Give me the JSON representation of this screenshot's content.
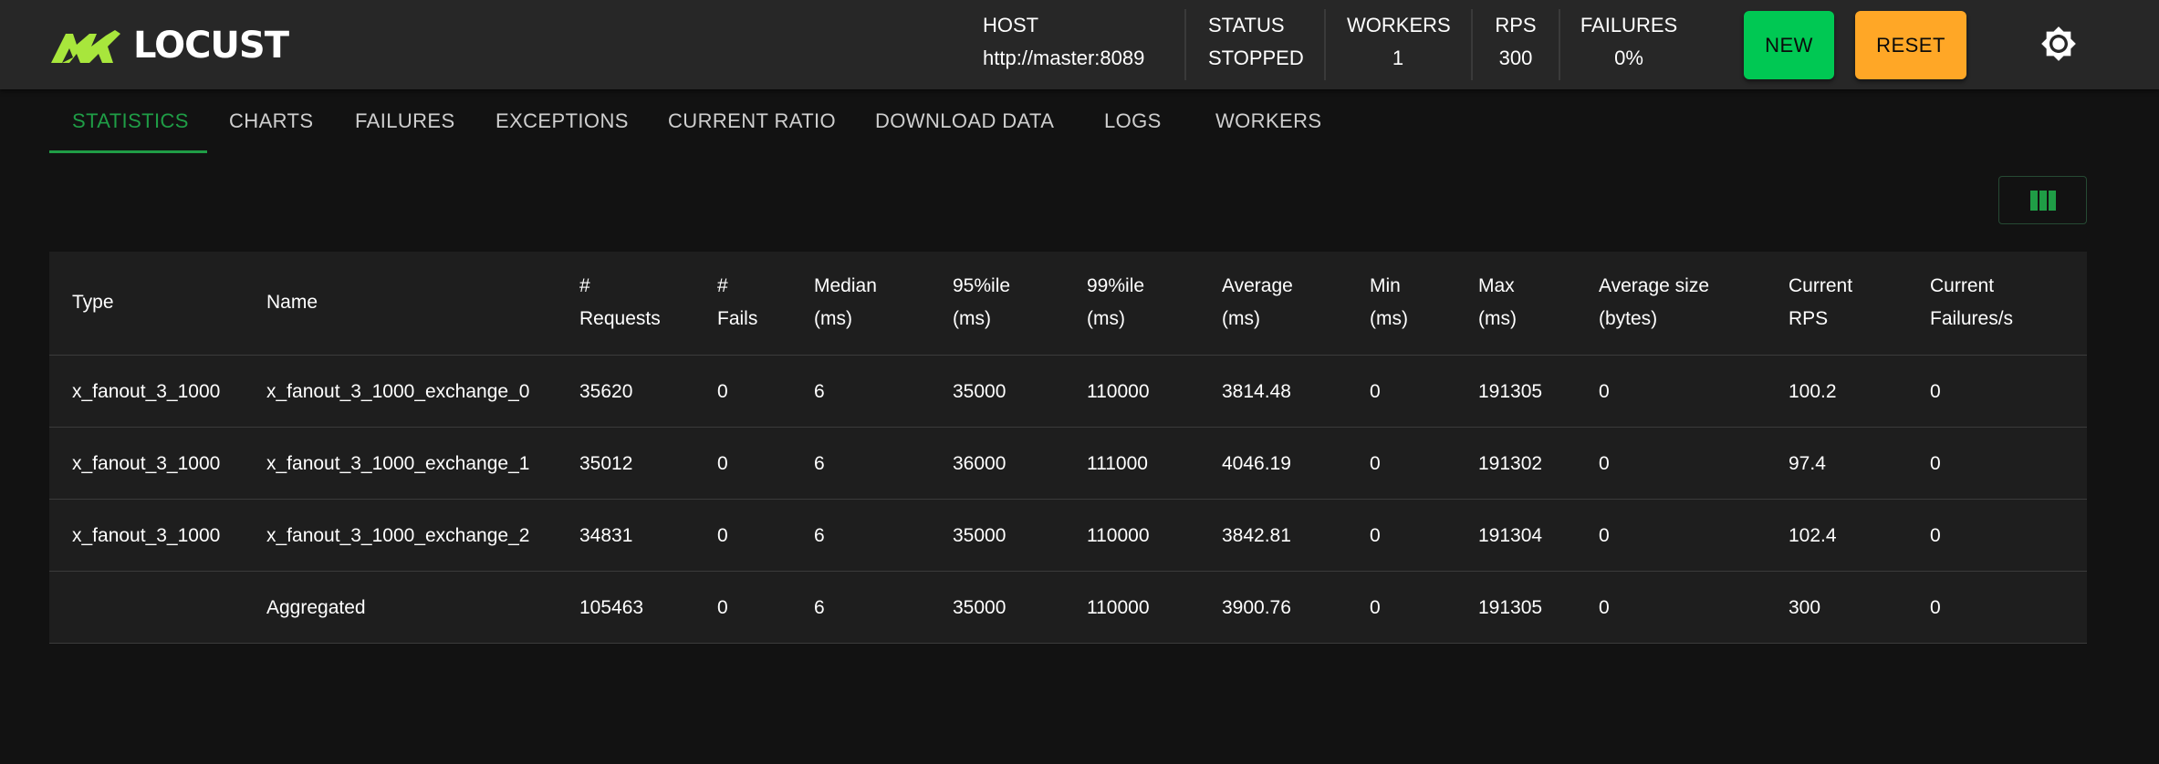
{
  "app": {
    "title": "LOCUST",
    "brand_color": "#a8e63c",
    "accent": "#1f9d46"
  },
  "header": {
    "host": {
      "label": "HOST",
      "value": "http://master:8089"
    },
    "status": {
      "label": "STATUS",
      "value": "STOPPED"
    },
    "workers": {
      "label": "WORKERS",
      "value": "1"
    },
    "rps": {
      "label": "RPS",
      "value": "300"
    },
    "failures": {
      "label": "FAILURES",
      "value": "0%"
    },
    "new_button": "NEW",
    "reset_button": "RESET",
    "theme_icon": "brightness-icon"
  },
  "tabs": [
    {
      "label": "STATISTICS",
      "active": true
    },
    {
      "label": "CHARTS"
    },
    {
      "label": "FAILURES"
    },
    {
      "label": "EXCEPTIONS"
    },
    {
      "label": "CURRENT RATIO"
    },
    {
      "label": "DOWNLOAD DATA"
    },
    {
      "label": "LOGS"
    },
    {
      "label": "WORKERS"
    }
  ],
  "toolbar": {
    "columns_icon": "view-column-icon"
  },
  "table": {
    "columns": [
      "Type",
      "Name",
      "#\nRequests",
      "#\nFails",
      "Median\n(ms)",
      "95%ile\n(ms)",
      "99%ile\n(ms)",
      "Average\n(ms)",
      "Min\n(ms)",
      "Max\n(ms)",
      "Average size\n(bytes)",
      "Current\nRPS",
      "Current\nFailures/s"
    ],
    "rows": [
      [
        "x_fanout_3_1000",
        "x_fanout_3_1000_exchange_0",
        "35620",
        "0",
        "6",
        "35000",
        "110000",
        "3814.48",
        "0",
        "191305",
        "0",
        "100.2",
        "0"
      ],
      [
        "x_fanout_3_1000",
        "x_fanout_3_1000_exchange_1",
        "35012",
        "0",
        "6",
        "36000",
        "111000",
        "4046.19",
        "0",
        "191302",
        "0",
        "97.4",
        "0"
      ],
      [
        "x_fanout_3_1000",
        "x_fanout_3_1000_exchange_2",
        "34831",
        "0",
        "6",
        "35000",
        "110000",
        "3842.81",
        "0",
        "191304",
        "0",
        "102.4",
        "0"
      ],
      [
        "",
        "Aggregated",
        "105463",
        "0",
        "6",
        "35000",
        "110000",
        "3900.76",
        "0",
        "191305",
        "0",
        "300",
        "0"
      ]
    ]
  }
}
